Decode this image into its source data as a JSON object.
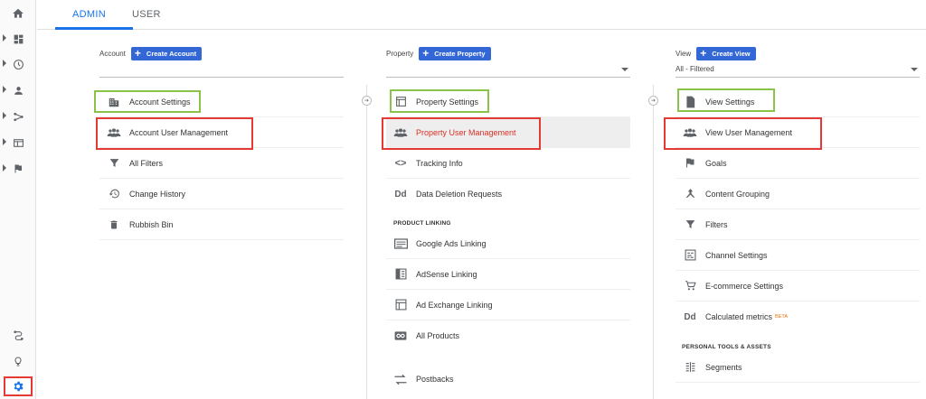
{
  "tabs": {
    "admin": "ADMIN",
    "user": "USER"
  },
  "rail": {
    "icons": [
      "home-icon",
      "dashboard-icon",
      "clock-icon",
      "person-icon",
      "fork-icon",
      "display-icon",
      "flag-icon"
    ],
    "bottom_icons": [
      "attribution-icon",
      "lightbulb-icon",
      "gear-icon"
    ]
  },
  "account": {
    "label": "Account",
    "create": "Create Account",
    "items": [
      "Account Settings",
      "Account User Management",
      "All Filters",
      "Change History",
      "Rubbish Bin"
    ]
  },
  "property": {
    "label": "Property",
    "create": "Create Property",
    "items": [
      "Property Settings",
      "Property User Management",
      "Tracking Info",
      "Data Deletion Requests"
    ],
    "section": "PRODUCT LINKING",
    "linking": [
      "Google Ads Linking",
      "AdSense Linking",
      "Ad Exchange Linking",
      "All Products",
      "Postbacks"
    ]
  },
  "view": {
    "label": "View",
    "create": "Create View",
    "select_value": "All - Filtered",
    "items": [
      "View Settings",
      "View User Management",
      "Goals",
      "Content Grouping",
      "Filters",
      "Channel Settings",
      "E-commerce Settings",
      "Calculated metrics"
    ],
    "beta": "BETA",
    "section": "PERSONAL TOOLS & ASSETS",
    "tools": [
      "Segments"
    ]
  },
  "colors": {
    "accent": "#1a73e8",
    "button": "#3367d6",
    "highlight_green": "#8bc34a",
    "highlight_red": "#e53935"
  }
}
